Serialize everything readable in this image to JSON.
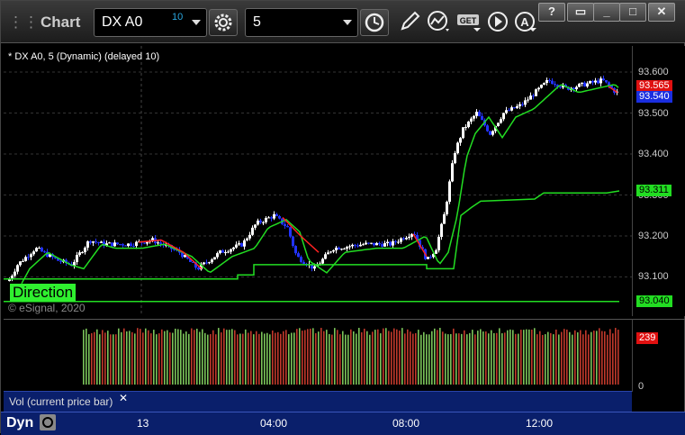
{
  "titlebar": {
    "app_title": "Chart",
    "symbol": "DX A0",
    "symbol_delay": "10",
    "interval": "5",
    "window_buttons": [
      "?",
      "▭",
      "□",
      "✕"
    ]
  },
  "chart": {
    "status_line": "* DX A0, 5 (Dynamic) (delayed 10)",
    "copyright": "© eSignal, 2020",
    "direction_label": "Direction",
    "price_ticks": [
      "93.600",
      "93.500",
      "93.400",
      "93.300",
      "93.200",
      "93.100"
    ],
    "tags": {
      "last_high": "93.565",
      "last": "93.540",
      "mid_line": "93.311",
      "low_line": "93.040"
    },
    "colors": {
      "up_bar": "#ffffff",
      "down_bar": "#2233ff",
      "green_line": "#22dd22",
      "red_line": "#ff2222",
      "tag_red": "#e01010",
      "tag_blue": "#1a2ee0",
      "tag_green": "#22dd22"
    }
  },
  "volume": {
    "last_value": "239",
    "zero_label": "0",
    "study_label": "Vol (current price bar)",
    "close_symbol": "✕"
  },
  "timeaxis": {
    "dyn_label": "Dyn",
    "labels": [
      "13",
      "04:00",
      "08:00",
      "12:00"
    ]
  }
}
